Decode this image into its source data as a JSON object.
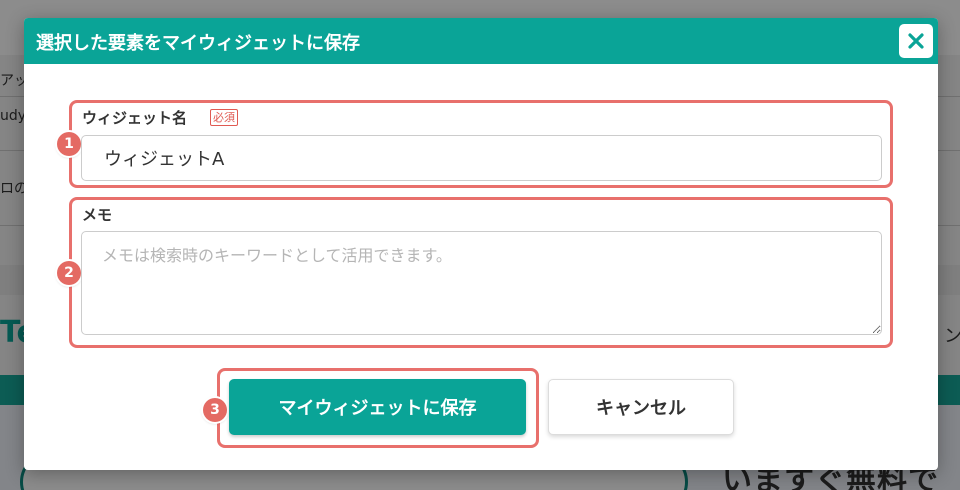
{
  "background": {
    "fragments": [
      "アッ",
      "udy",
      "ロの",
      "Te",
      "ン"
    ],
    "banner_text": "いますぐ無料で"
  },
  "modal": {
    "title": "選択した要素をマイウィジェットに保存",
    "fields": {
      "widget_name": {
        "label": "ウィジェット名",
        "required_label": "必須",
        "value": "ウィジェットA"
      },
      "memo": {
        "label": "メモ",
        "placeholder": "メモは検索時のキーワードとして活用できます。",
        "value": ""
      }
    },
    "buttons": {
      "save_label": "マイウィジェットに保存",
      "cancel_label": "キャンセル"
    },
    "step_badges": [
      "1",
      "2",
      "3"
    ]
  },
  "colors": {
    "accent": "#0aa497",
    "highlight": "#e8706c",
    "required": "#e05a52"
  }
}
